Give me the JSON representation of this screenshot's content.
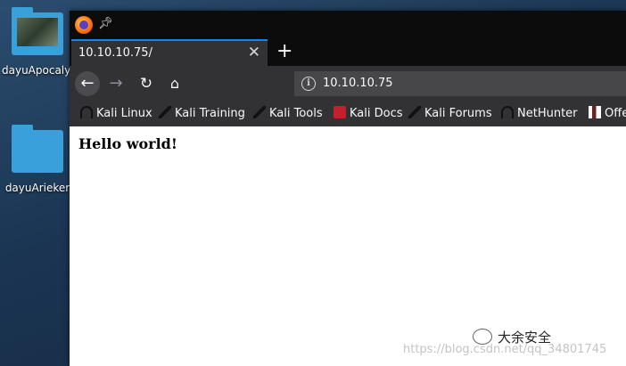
{
  "desktop": {
    "icons": [
      {
        "label": "dayuApocalyp"
      },
      {
        "label": "dayuArieker"
      }
    ]
  },
  "browser": {
    "tab": {
      "title": "10.10.10.75/"
    },
    "url": "10.10.10.75",
    "bookmarks": [
      {
        "label": "Kali Linux",
        "icon": "kali-icon"
      },
      {
        "label": "Kali Training",
        "icon": "dragon-icon"
      },
      {
        "label": "Kali Tools",
        "icon": "dragon-icon"
      },
      {
        "label": "Kali Docs",
        "icon": "kali-docs-icon"
      },
      {
        "label": "Kali Forums",
        "icon": "dragon-icon"
      },
      {
        "label": "NetHunter",
        "icon": "kali-icon"
      },
      {
        "label": "Offe",
        "icon": "offsec-icon"
      }
    ],
    "page": {
      "heading": "Hello world!"
    }
  },
  "overlay": {
    "wechat_label": "大余安全",
    "watermark": "https://blog.csdn.net/qq_34801745"
  },
  "colors": {
    "accent": "#0a84ff",
    "toolbar": "#323234",
    "titlebar": "#0c0c0d"
  }
}
